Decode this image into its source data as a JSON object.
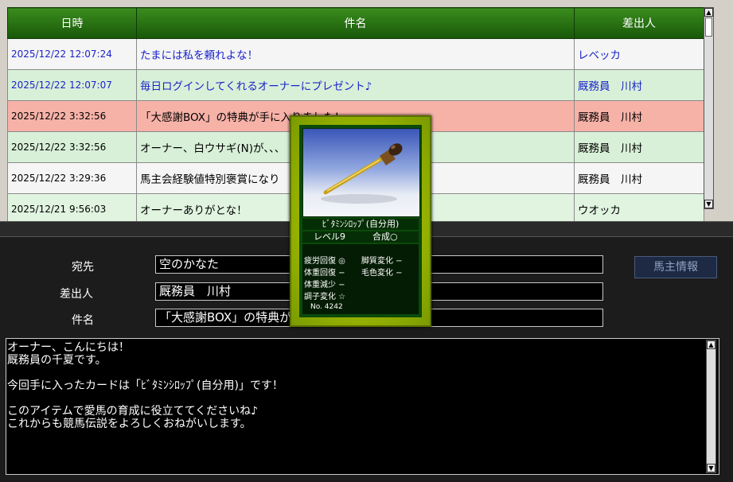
{
  "table": {
    "headers": {
      "date": "日時",
      "subject": "件名",
      "sender": "差出人"
    },
    "rows": [
      {
        "date": "2025/12/22 12:07:24",
        "subject": "たまには私を頼れよな！",
        "sender": "レベッカ"
      },
      {
        "date": "2025/12/22 12:07:07",
        "subject": "毎日ログインしてくれるオーナーにプレゼント♪",
        "sender": "厩務員　川村"
      },
      {
        "date": "2025/12/22 3:32:56",
        "subject": "「大感謝BOX」の特典が手に入りました！",
        "sender": "厩務員　川村"
      },
      {
        "date": "2025/12/22 3:32:56",
        "subject": "オーナー、白ウサギ(N)が、、、",
        "sender": "厩務員　川村"
      },
      {
        "date": "2025/12/22 3:29:36",
        "subject": "馬主会経験値特別褒賞になり",
        "sender": "厩務員　川村"
      },
      {
        "date": "2025/12/21 9:56:03",
        "subject": "オーナーありがとな！",
        "sender": "ウオッカ"
      }
    ]
  },
  "form": {
    "to_label": "宛先",
    "to_value": "空のかなた",
    "from_label": "差出人",
    "from_value": "厩務員　川村",
    "subject_label": "件名",
    "subject_value": "「大感謝BOX」の特典が",
    "owner_info_button": "馬主情報"
  },
  "body": {
    "lines": [
      "オーナー、こんにちは！",
      "厩務員の千夏です。",
      "",
      "今回手に入ったカードは「ﾋﾞﾀﾐﾝｼﾛｯﾌﾟ(自分用)」です！",
      "",
      "このアイテムで愛馬の育成に役立ててくださいね♪",
      "これからも競馬伝説をよろしくおねがいします。"
    ]
  },
  "card": {
    "name": "ﾋﾞﾀﾐﾝｼﾛｯﾌﾟ(自分用)",
    "level": "レベル9",
    "synthesis": "合成○",
    "stats": {
      "fatigue_recovery": "疲労回復 ◎",
      "leg_change": "脚質変化 −",
      "weight_gain": "体重回復 −",
      "coat_change": "毛色変化 −",
      "weight_loss": "体重減少 −",
      "condition_change": "調子変化 ☆"
    },
    "number": "No. 4242"
  },
  "colors": {
    "header_green": "#2a7a14",
    "link_blue": "#1a23c8",
    "highlight_red": "#f7b2a8",
    "row_green": "#d8f0d8"
  }
}
